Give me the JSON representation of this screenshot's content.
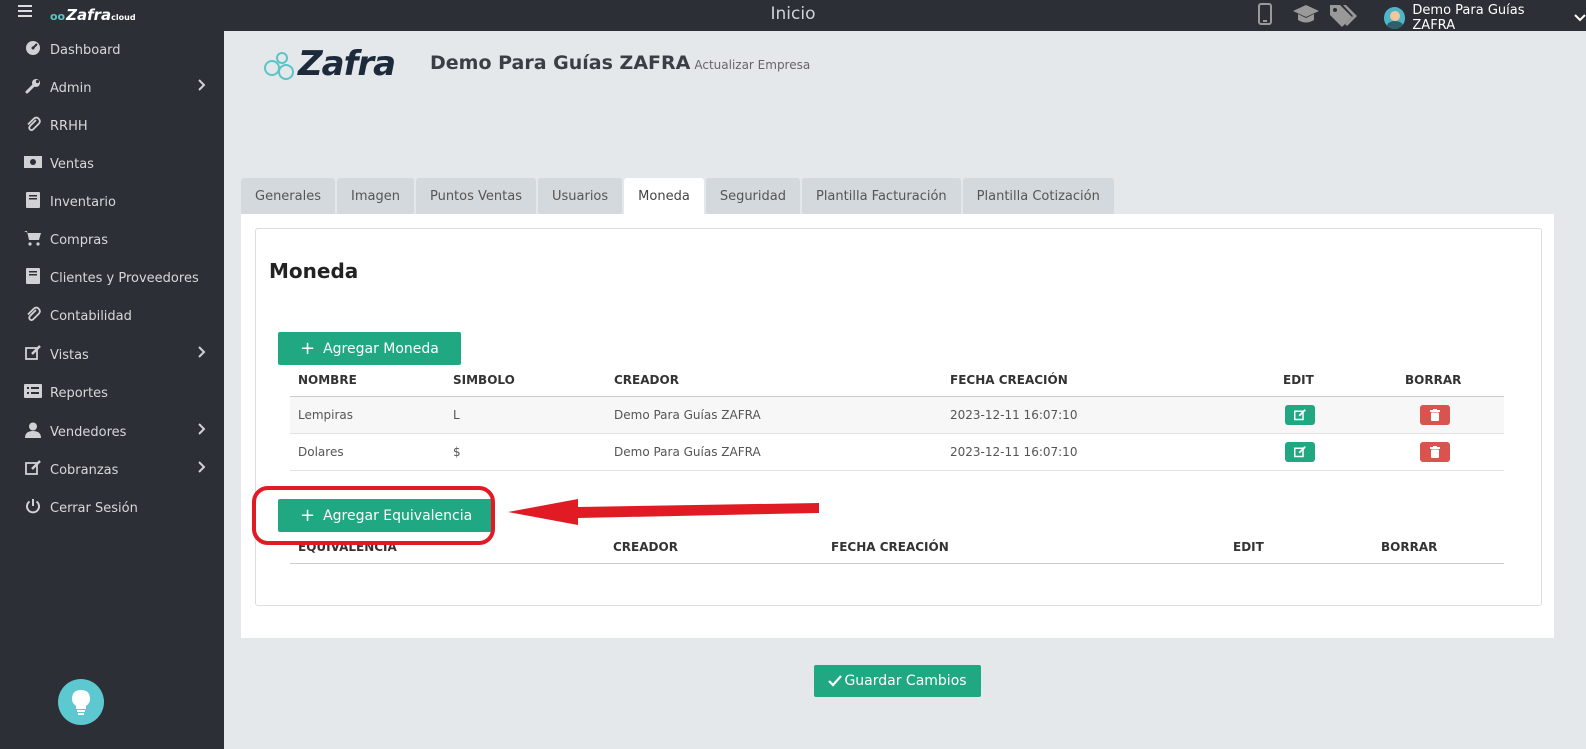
{
  "topbar": {
    "logo": "Zafra",
    "logo_suffix": "cloud",
    "title": "Inicio",
    "user_name": "Demo Para Guías ZAFRA"
  },
  "sidebar": {
    "items": [
      {
        "label": "Dashboard",
        "icon": "dashboard-icon",
        "chevron": false
      },
      {
        "label": "Admin",
        "icon": "wrench-icon",
        "chevron": true
      },
      {
        "label": "RRHH",
        "icon": "paperclip-icon",
        "chevron": false
      },
      {
        "label": "Ventas",
        "icon": "money-icon",
        "chevron": false
      },
      {
        "label": "Inventario",
        "icon": "book-icon",
        "chevron": false
      },
      {
        "label": "Compras",
        "icon": "cart-icon",
        "chevron": false
      },
      {
        "label": "Clientes y Proveedores",
        "icon": "book-icon",
        "chevron": false
      },
      {
        "label": "Contabilidad",
        "icon": "paperclip-icon",
        "chevron": false
      },
      {
        "label": "Vistas",
        "icon": "edit-icon",
        "chevron": true
      },
      {
        "label": "Reportes",
        "icon": "list-icon",
        "chevron": false
      },
      {
        "label": "Vendedores",
        "icon": "user-icon",
        "chevron": true
      },
      {
        "label": "Cobranzas",
        "icon": "edit-icon",
        "chevron": true
      },
      {
        "label": "Cerrar Sesión",
        "icon": "power-icon",
        "chevron": false
      }
    ]
  },
  "header": {
    "brand": "Zafra",
    "company": "Demo Para Guías ZAFRA",
    "subtitle": "Actualizar Empresa"
  },
  "tabs": [
    {
      "label": "Generales",
      "active": false
    },
    {
      "label": "Imagen",
      "active": false
    },
    {
      "label": "Puntos Ventas",
      "active": false
    },
    {
      "label": "Usuarios",
      "active": false
    },
    {
      "label": "Moneda",
      "active": true
    },
    {
      "label": "Seguridad",
      "active": false
    },
    {
      "label": "Plantilla Facturación",
      "active": false
    },
    {
      "label": "Plantilla Cotización",
      "active": false
    }
  ],
  "moneda": {
    "heading": "Moneda",
    "add_currency_label": "Agregar Moneda",
    "columns": [
      "NOMBRE",
      "SIMBOLO",
      "CREADOR",
      "FECHA CREACIÓN",
      "EDIT",
      "BORRAR"
    ],
    "rows": [
      {
        "nombre": "Lempiras",
        "simbolo": "L",
        "creador": "Demo Para Guías ZAFRA",
        "fecha": "2023-12-11 16:07:10"
      },
      {
        "nombre": "Dolares",
        "simbolo": "$",
        "creador": "Demo Para Guías ZAFRA",
        "fecha": "2023-12-11 16:07:10"
      }
    ],
    "add_equivalence_label": "Agregar Equivalencia",
    "equiv_columns": [
      "EQUIVALENCIA",
      "CREADOR",
      "FECHA CREACIÓN",
      "EDIT",
      "BORRAR"
    ]
  },
  "save_label": "Guardar Cambios",
  "colors": {
    "green": "#20a882",
    "red": "#d9534f",
    "sidebar": "#2c2f35",
    "annotation": "#e01b24"
  }
}
